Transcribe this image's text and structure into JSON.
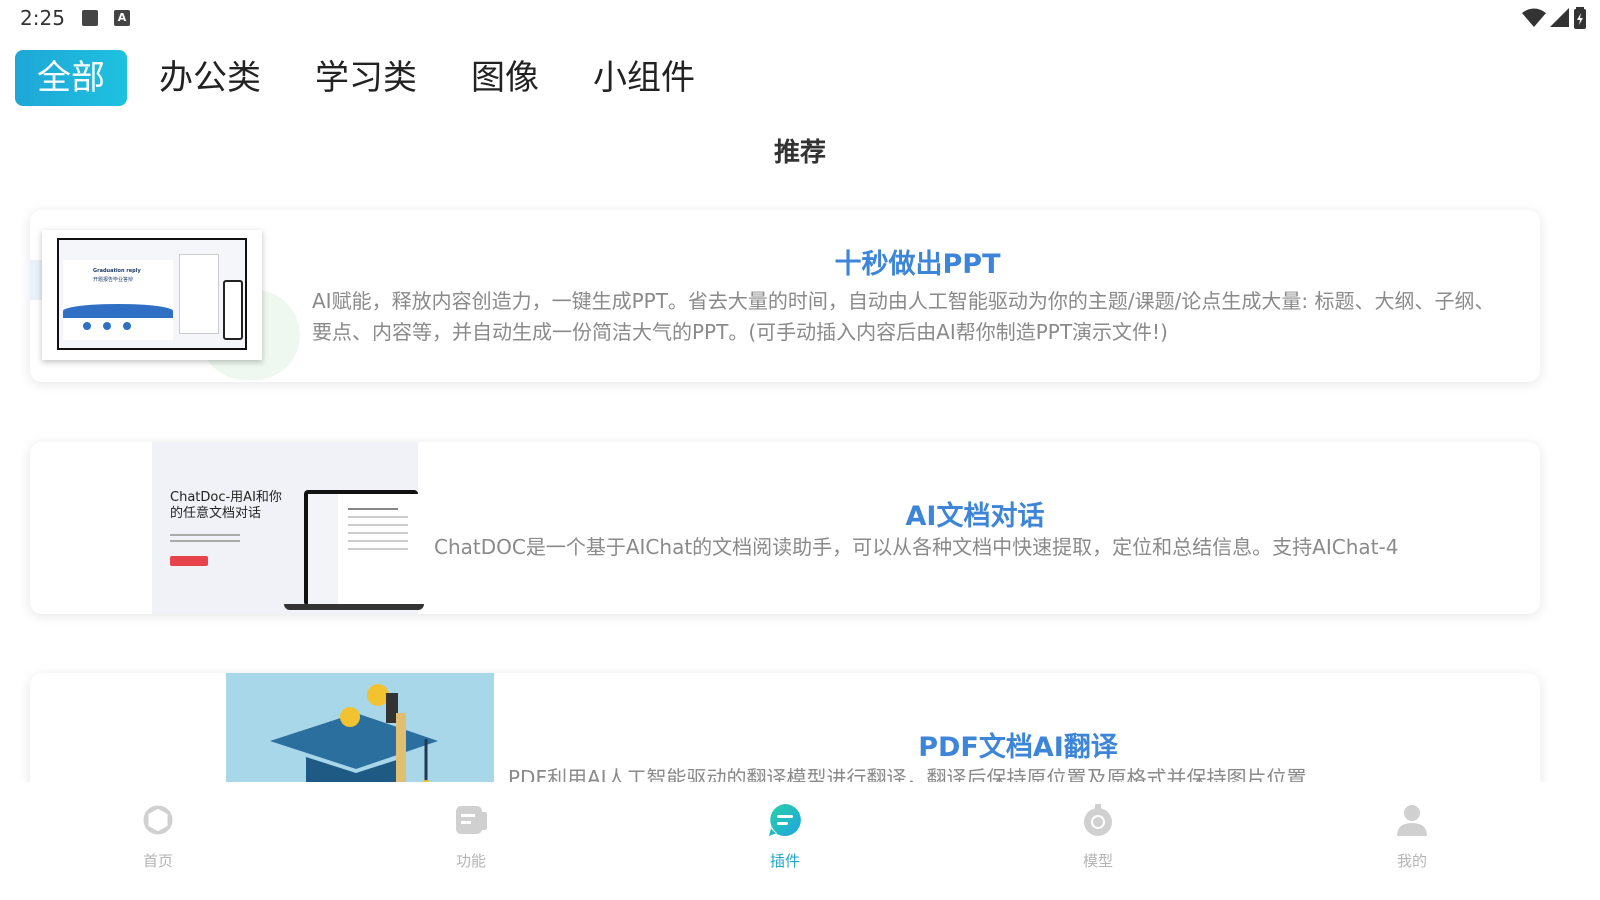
{
  "status_bar": {
    "time": "2:25",
    "a_badge": "A"
  },
  "tabs": [
    {
      "label": "全部",
      "active": true
    },
    {
      "label": "办公类"
    },
    {
      "label": "学习类"
    },
    {
      "label": "图像"
    },
    {
      "label": "小组件"
    }
  ],
  "section_title": "推荐",
  "cards": [
    {
      "title": "十秒做出PPT",
      "description": "AI赋能，释放内容创造力，一键生成PPT。省去大量的时间，自动由人工智能驱动为你的主题/课题/论点生成大量: 标题、大纲、子纲、要点、内容等，并自动生成一份简洁大气的PPT。(可手动插入内容后由AI帮你制造PPT演示文件!)",
      "thumb_title_en": "Graduation reply",
      "thumb_title_cn": "开题报告毕业答辩"
    },
    {
      "title": "AI文档对话",
      "description": "ChatDOC是一个基于AIChat的文档阅读助手，可以从各种文档中快速提取，定位和总结信息。支持AIChat-4",
      "thumb_headline": "ChatDoc-用AI和你的任意文档对话"
    },
    {
      "title": "PDF文档AI翻译",
      "description": "PDF利用AI人工智能驱动的翻译模型进行翻译，翻译后保持原位置及原格式并保持图片位置"
    }
  ],
  "bottom_nav": [
    {
      "label": "首页",
      "icon": "openai-logo-icon"
    },
    {
      "label": "功能",
      "icon": "function-icon"
    },
    {
      "label": "插件",
      "icon": "plugin-icon",
      "active": true
    },
    {
      "label": "模型",
      "icon": "model-icon"
    },
    {
      "label": "我的",
      "icon": "user-icon"
    }
  ],
  "colors": {
    "accent": "#1ea7d6",
    "title_blue": "#3d85d8",
    "nav_active": "#22a7c9",
    "nav_inactive": "#b5b5b5"
  }
}
